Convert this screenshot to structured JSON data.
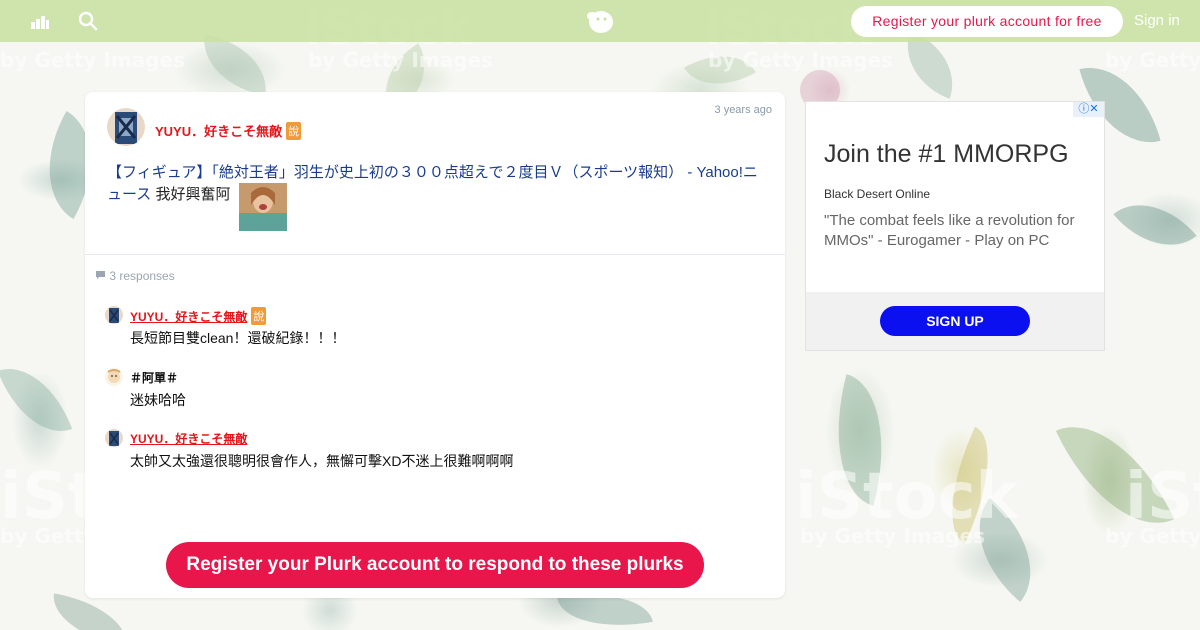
{
  "topbar": {
    "register_label": "Register your plurk account for free",
    "signin_label": "Sign in",
    "icons": [
      "stats-icon",
      "search-icon",
      "plurk-logo-icon"
    ]
  },
  "background": {
    "watermark_primary": "iStock",
    "watermark_secondary": "by Getty Images"
  },
  "plurk": {
    "poster": "YUYU．好きこそ無敵",
    "qualifier": "說",
    "time": "3 years ago",
    "link_text": "【フィギュア】「絶対王者」羽生が史上初の３００点超えで２度目Ｖ（スポーツ報知） - Yahoo!ニュース",
    "extra_text": "我好興奮阿"
  },
  "responses": {
    "count_text": "3 responses",
    "items": [
      {
        "name": "YUYU．好きこそ無敵",
        "qualifier": "說",
        "text": "長短節目雙clean！還破紀錄！！！",
        "name_color": "#e4161a"
      },
      {
        "name": "＃阿單＃",
        "qualifier": "",
        "text": "迷妹哈哈",
        "name_color": "#111111"
      },
      {
        "name": "YUYU．好きこそ無敵",
        "qualifier": "",
        "text": "太帥又太強還很聰明很會作人，無懈可擊XD不迷上很難啊啊啊",
        "name_color": "#e4161a"
      }
    ]
  },
  "cta": {
    "label": "Register your Plurk account to respond to these plurks"
  },
  "ad": {
    "title": "Join the #1 MMORPG",
    "advertiser": "Black Desert Online",
    "description": "\"The combat feels like a revolution for MMOs\" - Eurogamer - Play on PC",
    "button": "SIGN UP",
    "close_glyph": "ⓘ✕"
  },
  "colors": {
    "accent": "#e8164a",
    "name_red": "#e4161a",
    "link_blue": "#1a3c8e",
    "topbar": "#c8e1a0",
    "ad_button": "#0b10f0"
  }
}
